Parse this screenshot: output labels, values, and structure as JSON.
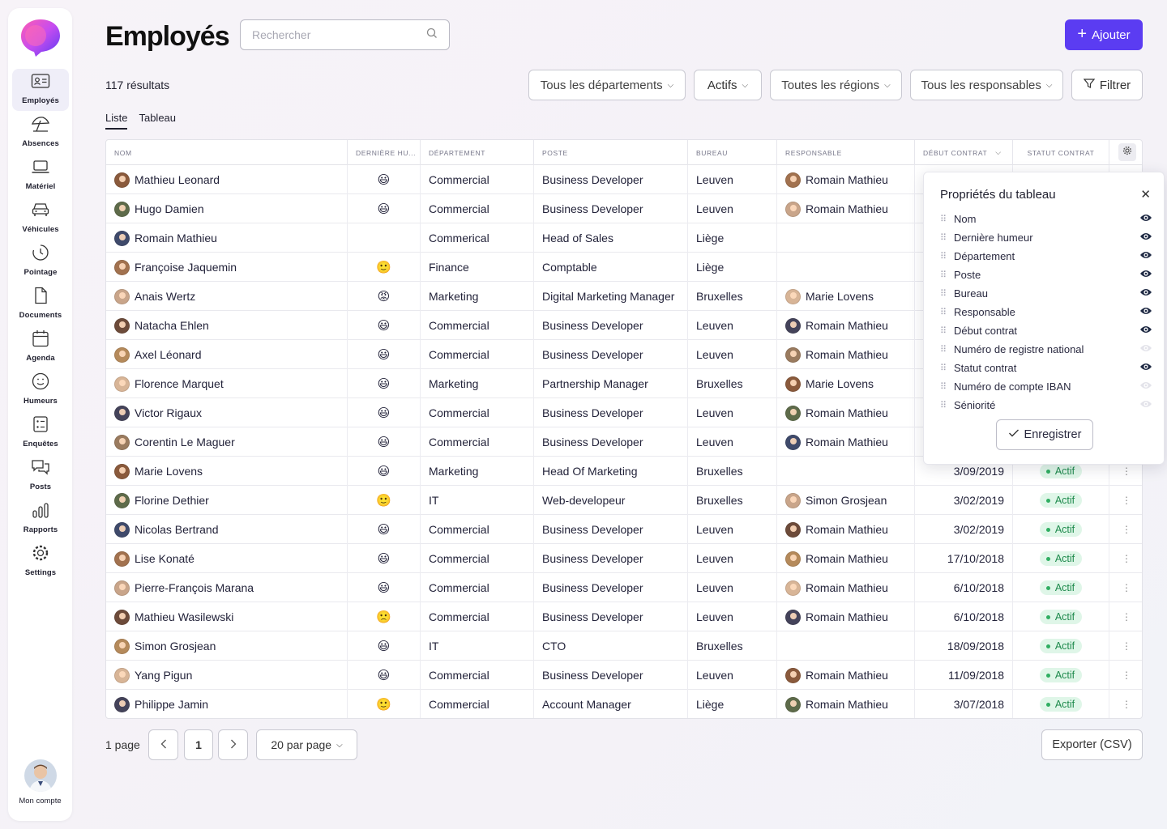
{
  "sidebar": {
    "items": [
      {
        "label": "Employés",
        "icon": "id-card-icon"
      },
      {
        "label": "Absences",
        "icon": "umbrella-icon"
      },
      {
        "label": "Matériel",
        "icon": "laptop-icon"
      },
      {
        "label": "Véhicules",
        "icon": "car-icon"
      },
      {
        "label": "Pointage",
        "icon": "clock-icon"
      },
      {
        "label": "Documents",
        "icon": "document-icon"
      },
      {
        "label": "Agenda",
        "icon": "calendar-icon"
      },
      {
        "label": "Humeurs",
        "icon": "smiley-icon"
      },
      {
        "label": "Enquêtes",
        "icon": "survey-icon"
      },
      {
        "label": "Posts",
        "icon": "chat-icon"
      },
      {
        "label": "Rapports",
        "icon": "bar-chart-icon"
      },
      {
        "label": "Settings",
        "icon": "gear-icon"
      }
    ],
    "account_label": "Mon compte"
  },
  "header": {
    "title": "Employés",
    "search_placeholder": "Rechercher",
    "add_label": "Ajouter"
  },
  "toolbar": {
    "results": "117 résultats",
    "filters": [
      "Tous les départements",
      "Actifs",
      "Toutes les régions",
      "Tous les responsables"
    ],
    "filter_button": "Filtrer"
  },
  "tabs": [
    "Liste",
    "Tableau"
  ],
  "table": {
    "columns": [
      "Nom",
      "Dernière hu...",
      "Département",
      "Poste",
      "Bureau",
      "Responsable",
      "Début contrat",
      "Statut contrat"
    ],
    "rows": [
      {
        "name": "Mathieu Leonard",
        "mood": "😃",
        "dept": "Commercial",
        "role": "Business Developer",
        "office": "Leuven",
        "manager": "Romain Mathieu",
        "start": "",
        "status": ""
      },
      {
        "name": "Hugo Damien",
        "mood": "😃",
        "dept": "Commercial",
        "role": "Business Developer",
        "office": "Leuven",
        "manager": "Romain Mathieu",
        "start": "",
        "status": ""
      },
      {
        "name": "Romain Mathieu",
        "mood": "",
        "dept": "Commerical",
        "role": "Head of Sales",
        "office": "Liège",
        "manager": "",
        "start": "",
        "status": ""
      },
      {
        "name": "Françoise Jaquemin",
        "mood": "🙂",
        "dept": "Finance",
        "role": "Comptable",
        "office": "Liège",
        "manager": "",
        "start": "",
        "status": ""
      },
      {
        "name": "Anais Wertz",
        "mood": "😡",
        "dept": "Marketing",
        "role": "Digital Marketing Manager",
        "office": "Bruxelles",
        "manager": "Marie Lovens",
        "start": "",
        "status": ""
      },
      {
        "name": "Natacha Ehlen",
        "mood": "😃",
        "dept": "Commercial",
        "role": "Business Developer",
        "office": "Leuven",
        "manager": "Romain Mathieu",
        "start": "",
        "status": ""
      },
      {
        "name": "Axel Léonard",
        "mood": "😃",
        "dept": "Commercial",
        "role": "Business Developer",
        "office": "Leuven",
        "manager": "Romain Mathieu",
        "start": "",
        "status": ""
      },
      {
        "name": "Florence Marquet",
        "mood": "😃",
        "dept": "Marketing",
        "role": "Partnership Manager",
        "office": "Bruxelles",
        "manager": "Marie Lovens",
        "start": "",
        "status": ""
      },
      {
        "name": "Victor Rigaux",
        "mood": "😃",
        "dept": "Commercial",
        "role": "Business Developer",
        "office": "Leuven",
        "manager": "Romain Mathieu",
        "start": "",
        "status": ""
      },
      {
        "name": "Corentin Le Maguer",
        "mood": "😃",
        "dept": "Commercial",
        "role": "Business Developer",
        "office": "Leuven",
        "manager": "Romain Mathieu",
        "start": "",
        "status": ""
      },
      {
        "name": "Marie Lovens",
        "mood": "😃",
        "dept": "Marketing",
        "role": "Head Of Marketing",
        "office": "Bruxelles",
        "manager": "",
        "start": "3/09/2019",
        "status": "Actif"
      },
      {
        "name": "Florine Dethier",
        "mood": "🙂",
        "dept": "IT",
        "role": "Web-developeur",
        "office": "Bruxelles",
        "manager": "Simon Grosjean",
        "start": "3/02/2019",
        "status": "Actif"
      },
      {
        "name": "Nicolas Bertrand",
        "mood": "😃",
        "dept": "Commercial",
        "role": "Business Developer",
        "office": "Leuven",
        "manager": "Romain Mathieu",
        "start": "3/02/2019",
        "status": "Actif"
      },
      {
        "name": "Lise Konaté",
        "mood": "😃",
        "dept": "Commercial",
        "role": "Business Developer",
        "office": "Leuven",
        "manager": "Romain Mathieu",
        "start": "17/10/2018",
        "status": "Actif"
      },
      {
        "name": "Pierre-François Marana",
        "mood": "😃",
        "dept": "Commercial",
        "role": "Business Developer",
        "office": "Leuven",
        "manager": "Romain Mathieu",
        "start": "6/10/2018",
        "status": "Actif"
      },
      {
        "name": "Mathieu Wasilewski",
        "mood": "🙁",
        "dept": "Commercial",
        "role": "Business Developer",
        "office": "Leuven",
        "manager": "Romain Mathieu",
        "start": "6/10/2018",
        "status": "Actif"
      },
      {
        "name": "Simon Grosjean",
        "mood": "😃",
        "dept": "IT",
        "role": "CTO",
        "office": "Bruxelles",
        "manager": "",
        "start": "18/09/2018",
        "status": "Actif"
      },
      {
        "name": "Yang Pigun",
        "mood": "😃",
        "dept": "Commercial",
        "role": "Business Developer",
        "office": "Leuven",
        "manager": "Romain Mathieu",
        "start": "11/09/2018",
        "status": "Actif"
      },
      {
        "name": "Philippe Jamin",
        "mood": "🙂",
        "dept": "Commercial",
        "role": "Account Manager",
        "office": "Liège",
        "manager": "Romain Mathieu",
        "start": "3/07/2018",
        "status": "Actif"
      }
    ]
  },
  "popover": {
    "title": "Propriétés du tableau",
    "properties": [
      {
        "label": "Nom",
        "visible": true
      },
      {
        "label": "Dernière humeur",
        "visible": true
      },
      {
        "label": "Département",
        "visible": true
      },
      {
        "label": "Poste",
        "visible": true
      },
      {
        "label": "Bureau",
        "visible": true
      },
      {
        "label": "Responsable",
        "visible": true
      },
      {
        "label": "Début contrat",
        "visible": true
      },
      {
        "label": "Numéro de registre national",
        "visible": false
      },
      {
        "label": "Statut contrat",
        "visible": true
      },
      {
        "label": "Numéro de compte IBAN",
        "visible": false
      },
      {
        "label": "Séniorité",
        "visible": false
      }
    ],
    "save_label": "Enregistrer"
  },
  "pagination": {
    "label": "1 page",
    "current": "1",
    "per_page": "20 par page"
  },
  "export_label": "Exporter (CSV)",
  "colors": {
    "accent": "#5b3cf2",
    "status_bg": "#dff6e8",
    "status_text": "#1e8a4c",
    "avatar_palette": [
      "#8a5a3c",
      "#5e6b4a",
      "#3f4a6b",
      "#a2724f",
      "#c9a58a",
      "#6d4b3a",
      "#b58a5b",
      "#d8b597",
      "#44435a",
      "#9a7b5f"
    ]
  }
}
